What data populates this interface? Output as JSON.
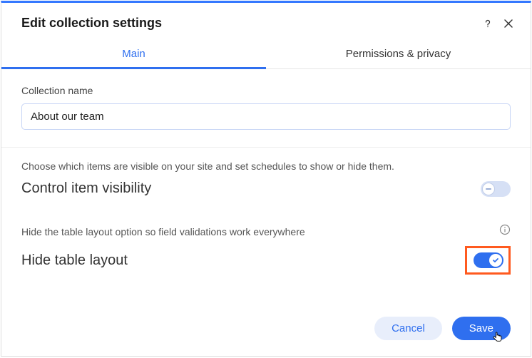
{
  "header": {
    "title": "Edit collection settings"
  },
  "tabs": {
    "main": "Main",
    "permissions": "Permissions & privacy"
  },
  "collectionName": {
    "label": "Collection name",
    "value": "About our team"
  },
  "visibility": {
    "helper": "Choose which items are visible on your site and set schedules to show or hide them.",
    "title": "Control item visibility",
    "enabled": false
  },
  "hideTable": {
    "helper": "Hide the table layout option so field validations work everywhere",
    "title": "Hide table layout",
    "enabled": true
  },
  "footer": {
    "cancel": "Cancel",
    "save": "Save"
  }
}
